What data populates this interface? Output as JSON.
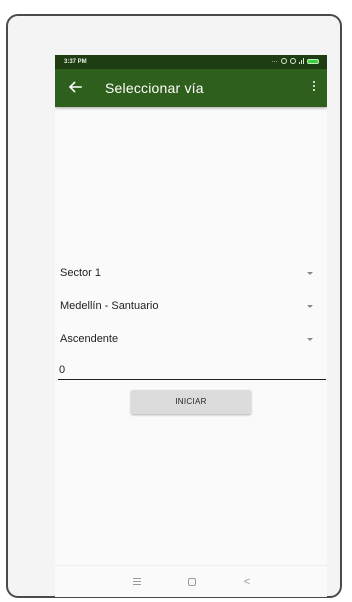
{
  "status_bar": {
    "time": "3:37 PM",
    "icons": [
      "more-dots-icon",
      "alarm-icon",
      "wifi-icon",
      "signal-icon",
      "battery-icon"
    ]
  },
  "toolbar": {
    "title": "Seleccionar vía",
    "back_icon": "arrow-back-icon",
    "menu_icon": "more-vert-icon"
  },
  "form": {
    "sector": "Sector 1",
    "route": "Medellín - Santuario",
    "direction": "Ascendente",
    "number_value": "0",
    "start_button": "INICIAR"
  },
  "nav_bar": {
    "icons": [
      "menu-icon",
      "home-icon",
      "back-icon"
    ]
  },
  "colors": {
    "status_bar": "#1f3d12",
    "toolbar": "#2f5f1c",
    "button": "#dcdcdc",
    "battery": "#3ecf3e"
  }
}
